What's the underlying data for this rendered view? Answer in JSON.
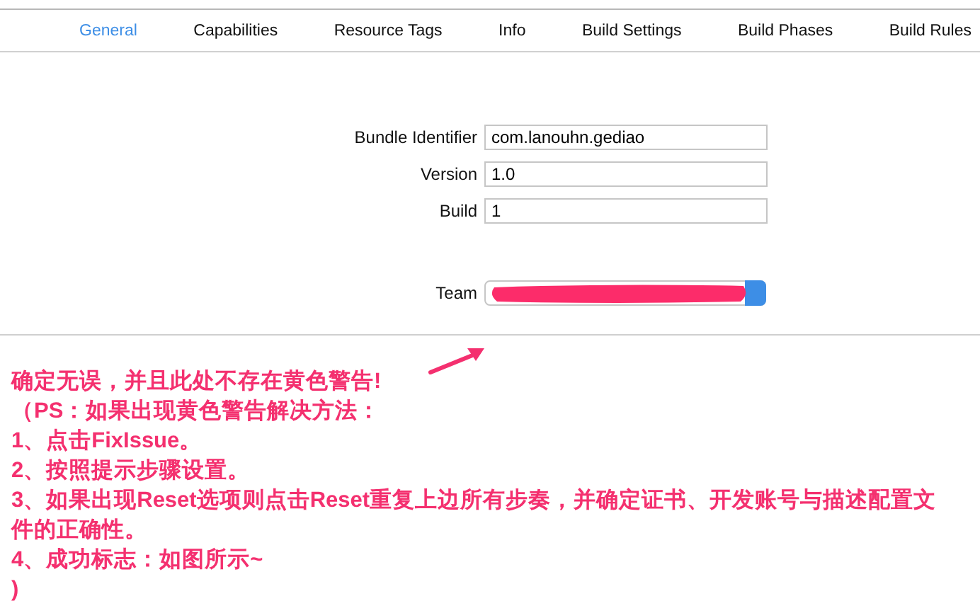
{
  "tabs": [
    {
      "label": "General",
      "selected": true
    },
    {
      "label": "Capabilities",
      "selected": false
    },
    {
      "label": "Resource Tags",
      "selected": false
    },
    {
      "label": "Info",
      "selected": false
    },
    {
      "label": "Build Settings",
      "selected": false
    },
    {
      "label": "Build Phases",
      "selected": false
    },
    {
      "label": "Build Rules",
      "selected": false
    }
  ],
  "identity": [
    {
      "label": "Bundle Identifier",
      "value": "com.lanouhn.gediao"
    },
    {
      "label": "Version",
      "value": "1.0"
    },
    {
      "label": "Build",
      "value": "1"
    }
  ],
  "team": {
    "label": "Team",
    "redacted": true
  },
  "annotation": {
    "lines": [
      "确定无误，并且此处不存在黄色警告!",
      "（PS：如果出现黄色警告解决方法：",
      "1、点击FixIssue。",
      "2、按照提示步骤设置。",
      "3、如果出现Reset选项则点击Reset重复上边所有步奏，并确定证书、开发账号与描述配置文件的正确性。",
      "4、成功标志：如图所示~",
      ")"
    ]
  }
}
